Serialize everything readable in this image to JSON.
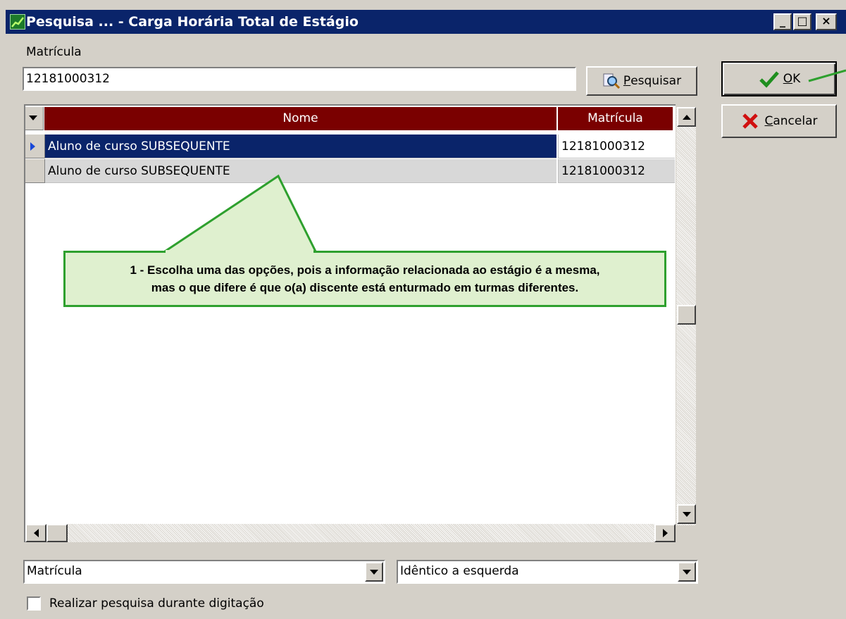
{
  "window": {
    "title": "Pesquisa ... - Carga Horária Total de Estágio",
    "minimize": "_",
    "maximize": "□",
    "close": "×"
  },
  "search": {
    "label": "Matrícula",
    "value": "12181000312",
    "button_label_first": "P",
    "button_label_rest": "esquisar"
  },
  "buttons": {
    "ok_first": "O",
    "ok_rest": "K",
    "cancel_first": "C",
    "cancel_rest": "ancelar"
  },
  "grid": {
    "columns": [
      "Nome",
      "Matrícula"
    ],
    "rows": [
      {
        "nome": "Aluno de curso SUBSEQUENTE",
        "matricula": "12181000312",
        "selected": true
      },
      {
        "nome": "Aluno de curso SUBSEQUENTE",
        "matricula": "12181000312",
        "selected": false
      }
    ]
  },
  "callout": {
    "line1": "1 - Escolha uma das opções, pois a informação relacionada ao estágio é a mesma,",
    "line2": "mas o que difere é que o(a) discente está enturmado em turmas diferentes."
  },
  "filters": {
    "field_select": "Matrícula",
    "mode_select": "Idêntico a esquerda"
  },
  "checkbox": {
    "label": "Realizar pesquisa durante digitação",
    "checked": false
  },
  "colors": {
    "titlebar": "#0a246a",
    "grid_header": "#7a0000",
    "selected_row": "#0a246a",
    "annotation_green": "#2ea02e",
    "annotation_fill": "#dff0cf"
  }
}
